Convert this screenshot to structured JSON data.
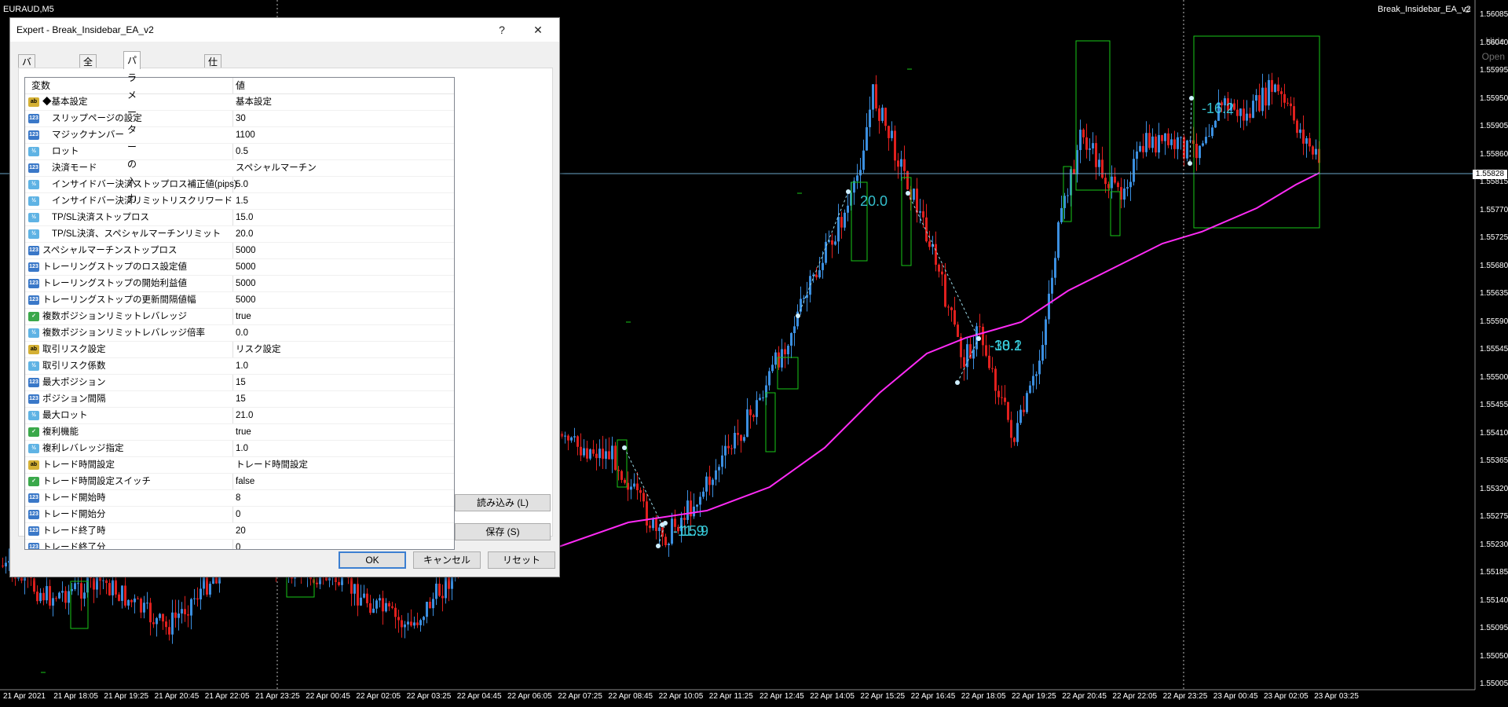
{
  "symbol": "EURAUD,M5",
  "ea_label": "Break_Insidebar_EA_v2",
  "side_labels": {
    "hide": "Hide",
    "open": "Open"
  },
  "current_price": "1.55828",
  "price_labels": [
    "1.56085",
    "1.56040",
    "1.55995",
    "1.55950",
    "1.55905",
    "1.55860",
    "1.55815",
    "1.55770",
    "1.55725",
    "1.55680",
    "1.55635",
    "1.55590",
    "1.55545",
    "1.55500",
    "1.55455",
    "1.55410",
    "1.55365",
    "1.55320",
    "1.55275",
    "1.55230",
    "1.55185",
    "1.55140",
    "1.55095",
    "1.55050",
    "1.55005"
  ],
  "time_labels": [
    "21 Apr 2021",
    "21 Apr 18:05",
    "21 Apr 19:25",
    "21 Apr 20:45",
    "21 Apr 22:05",
    "21 Apr 23:25",
    "22 Apr 00:45",
    "22 Apr 02:05",
    "22 Apr 03:25",
    "22 Apr 04:45",
    "22 Apr 06:05",
    "22 Apr 07:25",
    "22 Apr 08:45",
    "22 Apr 10:05",
    "22 Apr 11:25",
    "22 Apr 12:45",
    "22 Apr 14:05",
    "22 Apr 15:25",
    "22 Apr 16:45",
    "22 Apr 18:05",
    "22 Apr 19:25",
    "22 Apr 20:45",
    "22 Apr 22:05",
    "22 Apr 23:25",
    "23 Apr 00:45",
    "23 Apr 02:05",
    "23 Apr 03:25"
  ],
  "trade_labels": [
    {
      "text": "-11.9"
    },
    {
      "text": "15.9"
    },
    {
      "text": "20.0"
    },
    {
      "text": "-30.2"
    },
    {
      "text": "18.1"
    },
    {
      "text": "-16.2"
    }
  ],
  "dialog": {
    "title": "Expert - Break_Insidebar_EA_v2",
    "help": "?",
    "close": "✕",
    "tabs": [
      "バージョン情報",
      "全般",
      "パラメーターの入力",
      "仕様"
    ],
    "col_variable": "変数",
    "col_value": "値",
    "rows": [
      {
        "name": "◆基本設定",
        "value": "基本設定",
        "type": "str",
        "indent": false
      },
      {
        "name": "スリップページの設定",
        "value": "30",
        "type": "int",
        "indent": true
      },
      {
        "name": "マジックナンバー",
        "value": "1100",
        "type": "int",
        "indent": true
      },
      {
        "name": "ロット",
        "value": "0.5",
        "type": "dbl",
        "indent": true
      },
      {
        "name": "決済モード",
        "value": "スペシャルマーチン",
        "type": "int",
        "indent": true
      },
      {
        "name": "インサイドバー決済ストップロス補正値(pips)",
        "value": "5.0",
        "type": "dbl",
        "indent": true
      },
      {
        "name": "インサイドバー決済リミットリスクリワード",
        "value": "1.5",
        "type": "dbl",
        "indent": true
      },
      {
        "name": "TP/SL決済ストップロス",
        "value": "15.0",
        "type": "dbl",
        "indent": true
      },
      {
        "name": "TP/SL決済、スペシャルマーチンリミット",
        "value": "20.0",
        "type": "dbl",
        "indent": true
      },
      {
        "name": "スペシャルマーチンストップロス",
        "value": "5000",
        "type": "int",
        "indent": false
      },
      {
        "name": "トレーリングストップのロス設定値",
        "value": "5000",
        "type": "int",
        "indent": false
      },
      {
        "name": "トレーリングストップの開始利益値",
        "value": "5000",
        "type": "int",
        "indent": false
      },
      {
        "name": "トレーリングストップの更新間隔値幅",
        "value": "5000",
        "type": "int",
        "indent": false
      },
      {
        "name": "複数ポジションリミットレバレッジ",
        "value": "true",
        "type": "bool",
        "indent": false
      },
      {
        "name": "複数ポジションリミットレバレッジ倍率",
        "value": "0.0",
        "type": "dbl",
        "indent": false
      },
      {
        "name": "取引リスク設定",
        "value": "リスク設定",
        "type": "str",
        "indent": false
      },
      {
        "name": "取引リスク係数",
        "value": "1.0",
        "type": "dbl",
        "indent": false
      },
      {
        "name": "最大ポジション",
        "value": "15",
        "type": "int",
        "indent": false
      },
      {
        "name": "ポジション間隔",
        "value": "15",
        "type": "int",
        "indent": false
      },
      {
        "name": "最大ロット",
        "value": "21.0",
        "type": "dbl",
        "indent": false
      },
      {
        "name": "複利機能",
        "value": "true",
        "type": "bool",
        "indent": false
      },
      {
        "name": "複利レバレッジ指定",
        "value": "1.0",
        "type": "dbl",
        "indent": false
      },
      {
        "name": "トレード時間設定",
        "value": "トレード時間設定",
        "type": "str",
        "indent": false
      },
      {
        "name": "トレード時間設定スイッチ",
        "value": "false",
        "type": "bool",
        "indent": false
      },
      {
        "name": "トレード開始時",
        "value": "8",
        "type": "int",
        "indent": false
      },
      {
        "name": "トレード開始分",
        "value": "0",
        "type": "int",
        "indent": false
      },
      {
        "name": "トレード終了時",
        "value": "20",
        "type": "int",
        "indent": false
      },
      {
        "name": "トレード終了分",
        "value": "0",
        "type": "int",
        "indent": false
      }
    ],
    "load_button": "読み込み (L)",
    "save_button": "保存 (S)",
    "ok_button": "OK",
    "cancel_button": "キャンセル",
    "reset_button": "リセット"
  },
  "colors": {
    "bull": "#3b8fe0",
    "bear": "#e0201e",
    "ma": "#ff2bf6",
    "box": "#18c718",
    "trade_label": "#3ee0f0"
  }
}
